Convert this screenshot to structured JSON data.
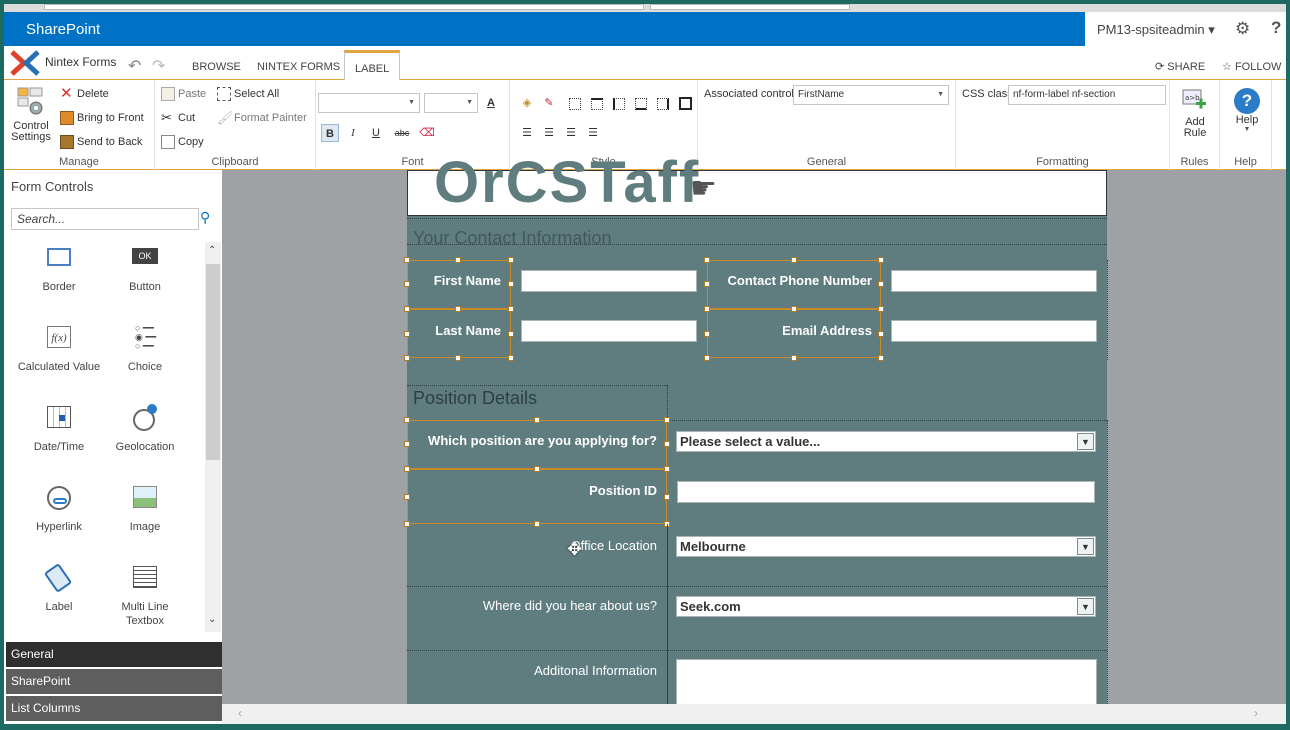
{
  "suite": {
    "brand": "SharePoint",
    "user": "PM13-spsiteadmin ▾"
  },
  "tabs": {
    "app_title": "Nintex Forms",
    "browse": "BROWSE",
    "nintex_forms": "NINTEX FORMS",
    "label": "LABEL",
    "share": "SHARE",
    "follow": "FOLLOW"
  },
  "ribbon": {
    "manage": {
      "label": "Manage",
      "control_settings": "Control Settings",
      "delete": "Delete",
      "bring_front": "Bring to Front",
      "send_back": "Send to Back"
    },
    "clipboard": {
      "label": "Clipboard",
      "paste": "Paste",
      "cut": "Cut",
      "copy": "Copy",
      "select_all": "Select All",
      "format_painter": "Format Painter"
    },
    "font": {
      "label": "Font",
      "bold": "B",
      "italic": "I",
      "underline": "U",
      "strike": "abc"
    },
    "style": {
      "label": "Style"
    },
    "general": {
      "label": "General",
      "associated_control_label": "Associated control",
      "associated_control_value": "FirstName"
    },
    "formatting": {
      "label": "Formatting",
      "css_class_label": "CSS class",
      "css_class_value": "nf-form-label nf-section"
    },
    "rules": {
      "label": "Rules",
      "add_rule": "Add Rule"
    },
    "help": {
      "label": "Help",
      "help": "Help"
    }
  },
  "left_panel": {
    "title": "Form Controls",
    "search_placeholder": "Search...",
    "controls": [
      {
        "label": "Border"
      },
      {
        "label": "Button"
      },
      {
        "label": "Calculated Value"
      },
      {
        "label": "Choice"
      },
      {
        "label": "Date/Time"
      },
      {
        "label": "Geolocation"
      },
      {
        "label": "Hyperlink"
      },
      {
        "label": "Image"
      },
      {
        "label": "Label"
      },
      {
        "label": "Multi Line Textbox"
      }
    ],
    "categories": [
      "General",
      "SharePoint",
      "List Columns"
    ]
  },
  "form": {
    "header_logo": "OrCSTaff",
    "contact_section": "Your Contact Information",
    "first_name": "First Name",
    "contact_phone": "Contact Phone Number",
    "last_name": "Last Name",
    "email": "Email Address",
    "position_section": "Position Details",
    "which_position": "Which position are you applying for?",
    "which_position_value": "Please select a value...",
    "position_id": "Position ID",
    "office_location": "Office Location",
    "office_location_value": "Melbourne",
    "where_hear": "Where did you hear about us?",
    "where_hear_value": "Seek.com",
    "additional_info": "Additonal Information"
  },
  "colors": {
    "suite_blue": "#0072c6",
    "accent_orange": "#e2a340",
    "form_bg": "#5f7d7e",
    "canvas_gray": "#9fa2a5"
  }
}
